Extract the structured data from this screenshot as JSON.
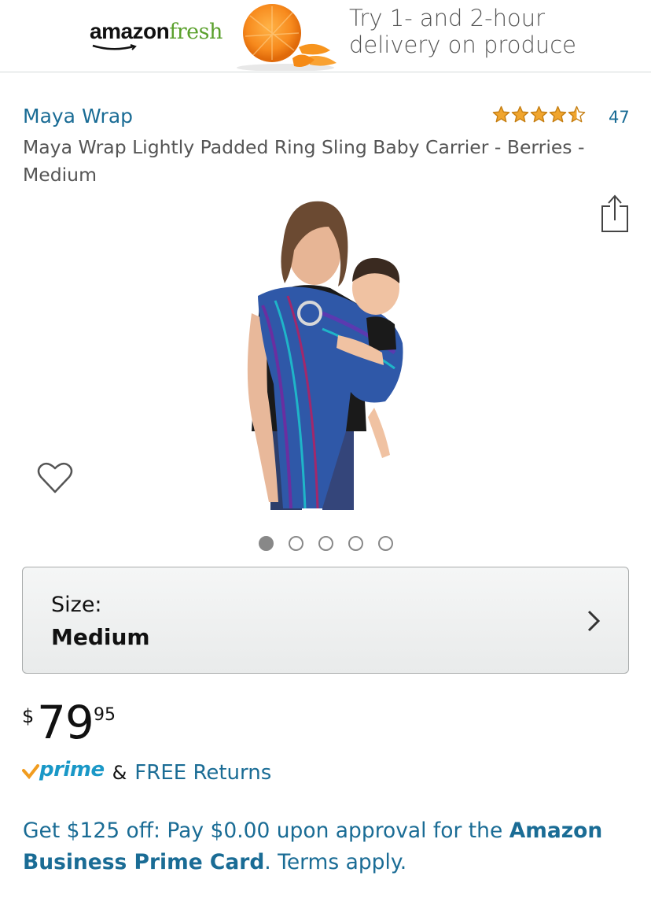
{
  "banner": {
    "brand_amazon": "amazon",
    "brand_fresh": "fresh",
    "line1": "Try 1- and 2-hour",
    "line2": "delivery on produce"
  },
  "product": {
    "brand": "Maya Wrap",
    "title": "Maya Wrap Lightly Padded Ring Sling Baby Carrier - Berries - Medium",
    "rating": 4.5,
    "review_count": "47",
    "image_count": 5,
    "active_image_index": 0
  },
  "size": {
    "label": "Size:",
    "value": "Medium"
  },
  "price": {
    "currency": "$",
    "whole": "79",
    "fraction": "95"
  },
  "shipping": {
    "prime": "prime",
    "amp": "&",
    "free_returns": "FREE Returns"
  },
  "promo": {
    "text_a": "Get $125 off: Pay $0.00 upon approval for the ",
    "text_b": "Amazon Business Prime Card",
    "text_c": ". Terms apply."
  },
  "colors": {
    "link": "#1a6c95",
    "star": "#f0a52e",
    "prime_blue": "#1a98c7",
    "prime_check": "#f19c1f",
    "fresh_green": "#5aa02c"
  },
  "icons": [
    "amazon-smile-icon",
    "star-icon",
    "share-icon",
    "heart-icon",
    "chevron-right-icon",
    "prime-check-icon"
  ]
}
